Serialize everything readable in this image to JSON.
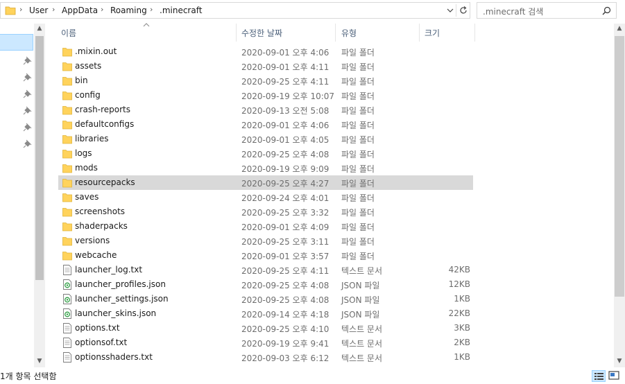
{
  "address": {
    "breadcrumbs": [
      "User",
      "AppData",
      "Roaming",
      ".minecraft"
    ]
  },
  "search": {
    "placeholder": ".minecraft 검색"
  },
  "columns": {
    "name": "이름",
    "date": "수정한 날짜",
    "type": "유형",
    "size": "크기"
  },
  "rows": [
    {
      "name": ".mixin.out",
      "date": "2020-09-01 오후 4:06",
      "type": "파일 폴더",
      "size": "",
      "icon": "folder-icon"
    },
    {
      "name": "assets",
      "date": "2020-09-01 오후 4:11",
      "type": "파일 폴더",
      "size": "",
      "icon": "folder-icon"
    },
    {
      "name": "bin",
      "date": "2020-09-25 오후 4:11",
      "type": "파일 폴더",
      "size": "",
      "icon": "folder-icon"
    },
    {
      "name": "config",
      "date": "2020-09-19 오후 10:07",
      "type": "파일 폴더",
      "size": "",
      "icon": "folder-icon"
    },
    {
      "name": "crash-reports",
      "date": "2020-09-13 오전 5:08",
      "type": "파일 폴더",
      "size": "",
      "icon": "folder-icon"
    },
    {
      "name": "defaultconfigs",
      "date": "2020-09-01 오후 4:06",
      "type": "파일 폴더",
      "size": "",
      "icon": "folder-icon"
    },
    {
      "name": "libraries",
      "date": "2020-09-01 오후 4:05",
      "type": "파일 폴더",
      "size": "",
      "icon": "folder-icon"
    },
    {
      "name": "logs",
      "date": "2020-09-25 오후 4:08",
      "type": "파일 폴더",
      "size": "",
      "icon": "folder-icon"
    },
    {
      "name": "mods",
      "date": "2020-09-19 오후 9:09",
      "type": "파일 폴더",
      "size": "",
      "icon": "folder-icon"
    },
    {
      "name": "resourcepacks",
      "date": "2020-09-25 오후 4:27",
      "type": "파일 폴더",
      "size": "",
      "icon": "folder-icon",
      "selected": true
    },
    {
      "name": "saves",
      "date": "2020-09-24 오후 4:01",
      "type": "파일 폴더",
      "size": "",
      "icon": "folder-icon"
    },
    {
      "name": "screenshots",
      "date": "2020-09-25 오후 3:32",
      "type": "파일 폴더",
      "size": "",
      "icon": "folder-icon"
    },
    {
      "name": "shaderpacks",
      "date": "2020-09-01 오후 4:09",
      "type": "파일 폴더",
      "size": "",
      "icon": "folder-icon"
    },
    {
      "name": "versions",
      "date": "2020-09-25 오후 3:11",
      "type": "파일 폴더",
      "size": "",
      "icon": "folder-icon"
    },
    {
      "name": "webcache",
      "date": "2020-09-01 오후 3:57",
      "type": "파일 폴더",
      "size": "",
      "icon": "folder-icon"
    },
    {
      "name": "launcher_log.txt",
      "date": "2020-09-25 오후 4:11",
      "type": "텍스트 문서",
      "size": "42KB",
      "icon": "text-file-icon"
    },
    {
      "name": "launcher_profiles.json",
      "date": "2020-09-25 오후 4:08",
      "type": "JSON 파일",
      "size": "12KB",
      "icon": "json-file-icon"
    },
    {
      "name": "launcher_settings.json",
      "date": "2020-09-25 오후 4:08",
      "type": "JSON 파일",
      "size": "1KB",
      "icon": "json-file-icon"
    },
    {
      "name": "launcher_skins.json",
      "date": "2020-09-14 오후 4:18",
      "type": "JSON 파일",
      "size": "22KB",
      "icon": "json-file-icon"
    },
    {
      "name": "options.txt",
      "date": "2020-09-25 오후 4:10",
      "type": "텍스트 문서",
      "size": "3KB",
      "icon": "text-file-icon"
    },
    {
      "name": "optionsof.txt",
      "date": "2020-09-19 오후 9:41",
      "type": "텍스트 문서",
      "size": "2KB",
      "icon": "text-file-icon"
    },
    {
      "name": "optionsshaders.txt",
      "date": "2020-09-03 오후 6:12",
      "type": "텍스트 문서",
      "size": "1KB",
      "icon": "text-file-icon"
    }
  ],
  "status": {
    "text": "1개 항목 선택함"
  },
  "colors": {
    "selection": "#d9d9d9",
    "folder": "#ffd35c",
    "header_text": "#4c607a"
  }
}
